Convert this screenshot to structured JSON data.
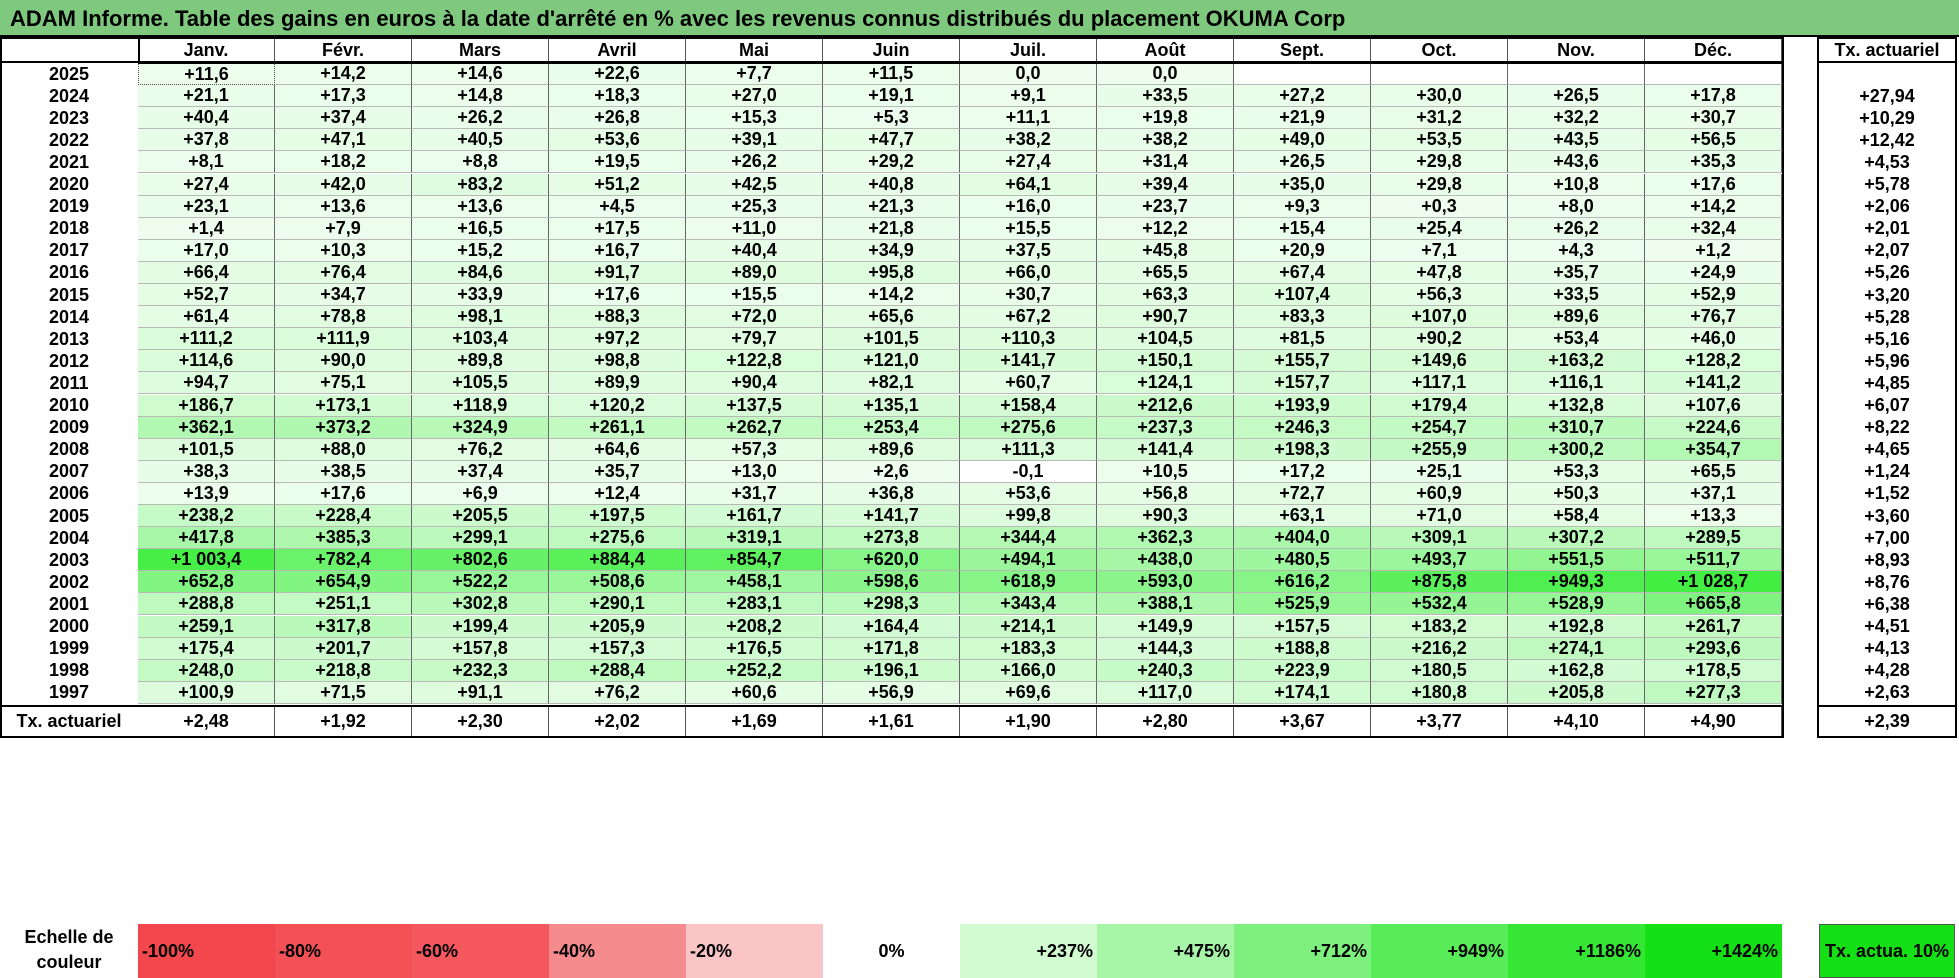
{
  "title": "ADAM Informe. Table des gains en euros à la date d'arrêté en % avec les revenus connus distribués du placement OKUMA Corp",
  "chart_data": {
    "type": "table",
    "columns": [
      "Janv.",
      "Févr.",
      "Mars",
      "Avril",
      "Mai",
      "Juin",
      "Juil.",
      "Août",
      "Sept.",
      "Oct.",
      "Nov.",
      "Déc."
    ],
    "rate_header": "Tx. actuariel",
    "rows": [
      {
        "year": "2025",
        "values": [
          "+11,6",
          "+14,2",
          "+14,6",
          "+22,6",
          "+7,7",
          "+11,5",
          "0,0",
          "0,0",
          "",
          "",
          "",
          ""
        ],
        "rate": ""
      },
      {
        "year": "2024",
        "values": [
          "+21,1",
          "+17,3",
          "+14,8",
          "+18,3",
          "+27,0",
          "+19,1",
          "+9,1",
          "+33,5",
          "+27,2",
          "+30,0",
          "+26,5",
          "+17,8"
        ],
        "rate": "+27,94"
      },
      {
        "year": "2023",
        "values": [
          "+40,4",
          "+37,4",
          "+26,2",
          "+26,8",
          "+15,3",
          "+5,3",
          "+11,1",
          "+19,8",
          "+21,9",
          "+31,2",
          "+32,2",
          "+30,7"
        ],
        "rate": "+10,29"
      },
      {
        "year": "2022",
        "values": [
          "+37,8",
          "+47,1",
          "+40,5",
          "+53,6",
          "+39,1",
          "+47,7",
          "+38,2",
          "+38,2",
          "+49,0",
          "+53,5",
          "+43,5",
          "+56,5"
        ],
        "rate": "+12,42"
      },
      {
        "year": "2021",
        "values": [
          "+8,1",
          "+18,2",
          "+8,8",
          "+19,5",
          "+26,2",
          "+29,2",
          "+27,4",
          "+31,4",
          "+26,5",
          "+29,8",
          "+43,6",
          "+35,3"
        ],
        "rate": "+4,53"
      },
      {
        "year": "2020",
        "values": [
          "+27,4",
          "+42,0",
          "+83,2",
          "+51,2",
          "+42,5",
          "+40,8",
          "+64,1",
          "+39,4",
          "+35,0",
          "+29,8",
          "+10,8",
          "+17,6"
        ],
        "rate": "+5,78"
      },
      {
        "year": "2019",
        "values": [
          "+23,1",
          "+13,6",
          "+13,6",
          "+4,5",
          "+25,3",
          "+21,3",
          "+16,0",
          "+23,7",
          "+9,3",
          "+0,3",
          "+8,0",
          "+14,2"
        ],
        "rate": "+2,06"
      },
      {
        "year": "2018",
        "values": [
          "+1,4",
          "+7,9",
          "+16,5",
          "+17,5",
          "+11,0",
          "+21,8",
          "+15,5",
          "+12,2",
          "+15,4",
          "+25,4",
          "+26,2",
          "+32,4"
        ],
        "rate": "+2,01"
      },
      {
        "year": "2017",
        "values": [
          "+17,0",
          "+10,3",
          "+15,2",
          "+16,7",
          "+40,4",
          "+34,9",
          "+37,5",
          "+45,8",
          "+20,9",
          "+7,1",
          "+4,3",
          "+1,2"
        ],
        "rate": "+2,07"
      },
      {
        "year": "2016",
        "values": [
          "+66,4",
          "+76,4",
          "+84,6",
          "+91,7",
          "+89,0",
          "+95,8",
          "+66,0",
          "+65,5",
          "+67,4",
          "+47,8",
          "+35,7",
          "+24,9"
        ],
        "rate": "+5,26"
      },
      {
        "year": "2015",
        "values": [
          "+52,7",
          "+34,7",
          "+33,9",
          "+17,6",
          "+15,5",
          "+14,2",
          "+30,7",
          "+63,3",
          "+107,4",
          "+56,3",
          "+33,5",
          "+52,9"
        ],
        "rate": "+3,20"
      },
      {
        "year": "2014",
        "values": [
          "+61,4",
          "+78,8",
          "+98,1",
          "+88,3",
          "+72,0",
          "+65,6",
          "+67,2",
          "+90,7",
          "+83,3",
          "+107,0",
          "+89,6",
          "+76,7"
        ],
        "rate": "+5,28"
      },
      {
        "year": "2013",
        "values": [
          "+111,2",
          "+111,9",
          "+103,4",
          "+97,2",
          "+79,7",
          "+101,5",
          "+110,3",
          "+104,5",
          "+81,5",
          "+90,2",
          "+53,4",
          "+46,0"
        ],
        "rate": "+5,16"
      },
      {
        "year": "2012",
        "values": [
          "+114,6",
          "+90,0",
          "+89,8",
          "+98,8",
          "+122,8",
          "+121,0",
          "+141,7",
          "+150,1",
          "+155,7",
          "+149,6",
          "+163,2",
          "+128,2"
        ],
        "rate": "+5,96"
      },
      {
        "year": "2011",
        "values": [
          "+94,7",
          "+75,1",
          "+105,5",
          "+89,9",
          "+90,4",
          "+82,1",
          "+60,7",
          "+124,1",
          "+157,7",
          "+117,1",
          "+116,1",
          "+141,2"
        ],
        "rate": "+4,85"
      },
      {
        "year": "2010",
        "values": [
          "+186,7",
          "+173,1",
          "+118,9",
          "+120,2",
          "+137,5",
          "+135,1",
          "+158,4",
          "+212,6",
          "+193,9",
          "+179,4",
          "+132,8",
          "+107,6"
        ],
        "rate": "+6,07"
      },
      {
        "year": "2009",
        "values": [
          "+362,1",
          "+373,2",
          "+324,9",
          "+261,1",
          "+262,7",
          "+253,4",
          "+275,6",
          "+237,3",
          "+246,3",
          "+254,7",
          "+310,7",
          "+224,6"
        ],
        "rate": "+8,22"
      },
      {
        "year": "2008",
        "values": [
          "+101,5",
          "+88,0",
          "+76,2",
          "+64,6",
          "+57,3",
          "+89,6",
          "+111,3",
          "+141,4",
          "+198,3",
          "+255,9",
          "+300,2",
          "+354,7"
        ],
        "rate": "+4,65"
      },
      {
        "year": "2007",
        "values": [
          "+38,3",
          "+38,5",
          "+37,4",
          "+35,7",
          "+13,0",
          "+2,6",
          "-0,1",
          "+10,5",
          "+17,2",
          "+25,1",
          "+53,3",
          "+65,5"
        ],
        "rate": "+1,24"
      },
      {
        "year": "2006",
        "values": [
          "+13,9",
          "+17,6",
          "+6,9",
          "+12,4",
          "+31,7",
          "+36,8",
          "+53,6",
          "+56,8",
          "+72,7",
          "+60,9",
          "+50,3",
          "+37,1"
        ],
        "rate": "+1,52"
      },
      {
        "year": "2005",
        "values": [
          "+238,2",
          "+228,4",
          "+205,5",
          "+197,5",
          "+161,7",
          "+141,7",
          "+99,8",
          "+90,3",
          "+63,1",
          "+71,0",
          "+58,4",
          "+13,3"
        ],
        "rate": "+3,60"
      },
      {
        "year": "2004",
        "values": [
          "+417,8",
          "+385,3",
          "+299,1",
          "+275,6",
          "+319,1",
          "+273,8",
          "+344,4",
          "+362,3",
          "+404,0",
          "+309,1",
          "+307,2",
          "+289,5"
        ],
        "rate": "+7,00"
      },
      {
        "year": "2003",
        "values": [
          "+1 003,4",
          "+782,4",
          "+802,6",
          "+884,4",
          "+854,7",
          "+620,0",
          "+494,1",
          "+438,0",
          "+480,5",
          "+493,7",
          "+551,5",
          "+511,7"
        ],
        "rate": "+8,93"
      },
      {
        "year": "2002",
        "values": [
          "+652,8",
          "+654,9",
          "+522,2",
          "+508,6",
          "+458,1",
          "+598,6",
          "+618,9",
          "+593,0",
          "+616,2",
          "+875,8",
          "+949,3",
          "+1 028,7"
        ],
        "rate": "+8,76"
      },
      {
        "year": "2001",
        "values": [
          "+288,8",
          "+251,1",
          "+302,8",
          "+290,1",
          "+283,1",
          "+298,3",
          "+343,4",
          "+388,1",
          "+525,9",
          "+532,4",
          "+528,9",
          "+665,8"
        ],
        "rate": "+6,38"
      },
      {
        "year": "2000",
        "values": [
          "+259,1",
          "+317,8",
          "+199,4",
          "+205,9",
          "+208,2",
          "+164,4",
          "+214,1",
          "+149,9",
          "+157,5",
          "+183,2",
          "+192,8",
          "+261,7"
        ],
        "rate": "+4,51"
      },
      {
        "year": "1999",
        "values": [
          "+175,4",
          "+201,7",
          "+157,8",
          "+157,3",
          "+176,5",
          "+171,8",
          "+183,3",
          "+144,3",
          "+188,8",
          "+216,2",
          "+274,1",
          "+293,6"
        ],
        "rate": "+4,13"
      },
      {
        "year": "1998",
        "values": [
          "+248,0",
          "+218,8",
          "+232,3",
          "+288,4",
          "+252,2",
          "+196,1",
          "+166,0",
          "+240,3",
          "+223,9",
          "+180,5",
          "+162,8",
          "+178,5"
        ],
        "rate": "+4,28"
      },
      {
        "year": "1997",
        "values": [
          "+100,9",
          "+71,5",
          "+91,1",
          "+76,2",
          "+60,6",
          "+56,9",
          "+69,6",
          "+117,0",
          "+174,1",
          "+180,8",
          "+205,8",
          "+277,3"
        ],
        "rate": "+2,63"
      }
    ],
    "footer": {
      "label": "Tx. actuariel",
      "values": [
        "+2,48",
        "+1,92",
        "+2,30",
        "+2,02",
        "+1,69",
        "+1,61",
        "+1,90",
        "+2,80",
        "+3,67",
        "+3,77",
        "+4,10",
        "+4,90"
      ],
      "rate": "+2,39"
    }
  },
  "scale": {
    "label": "Echelle de couleur",
    "items": [
      {
        "text": "-100%",
        "color": "#f2474c",
        "align": "left"
      },
      {
        "text": "-80%",
        "color": "#f35156",
        "align": "left"
      },
      {
        "text": "-60%",
        "color": "#f4575d",
        "align": "left"
      },
      {
        "text": "-40%",
        "color": "#f68b8e",
        "align": "left"
      },
      {
        "text": "-20%",
        "color": "#fbc4c5",
        "align": "left"
      },
      {
        "text": "0%",
        "color": "#ffffff",
        "align": "center"
      },
      {
        "text": "+237%",
        "color": "#d2fbd2",
        "align": "right"
      },
      {
        "text": "+475%",
        "color": "#a7f5a7",
        "align": "right"
      },
      {
        "text": "+712%",
        "color": "#7df07d",
        "align": "right"
      },
      {
        "text": "+949%",
        "color": "#58ec58",
        "align": "right"
      },
      {
        "text": "+1186%",
        "color": "#35e635",
        "align": "right"
      },
      {
        "text": "+1424%",
        "color": "#15e015",
        "align": "right"
      }
    ],
    "rate_label": "Tx. actua. 10%",
    "rate_color": "#15e015"
  }
}
